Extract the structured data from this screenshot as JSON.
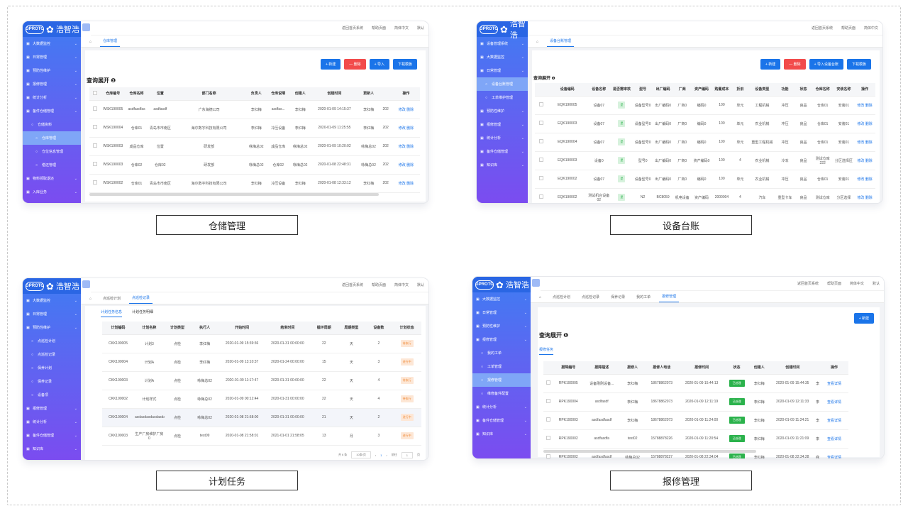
{
  "brand": {
    "logo": "GPROTO",
    "name": "浩智浩"
  },
  "topbar": {
    "home": "返回首页系统",
    "fullscreen": "帮助页面",
    "lang": "简体中文",
    "user": "默认"
  },
  "captions": {
    "warehouse": "仓储管理",
    "equipment": "设备台账",
    "plan": "计划任务",
    "repair": "报修管理"
  },
  "warehouse": {
    "menu": [
      {
        "label": "大数据监控",
        "level": 0
      },
      {
        "label": "日常管理",
        "level": 0
      },
      {
        "label": "预防性维护",
        "level": 0
      },
      {
        "label": "报修管理",
        "level": 0
      },
      {
        "label": "统计分析",
        "level": 0
      },
      {
        "label": "备件仓储管理",
        "level": 0
      },
      {
        "label": "仓储资料",
        "level": 1
      },
      {
        "label": "仓库管理",
        "level": 2,
        "active": true
      },
      {
        "label": "仓位信息管理",
        "level": 2
      },
      {
        "label": "借还管理",
        "level": 2
      },
      {
        "label": "物料领取退还",
        "level": 0
      },
      {
        "label": "入库业务",
        "level": 0
      },
      {
        "label": "出库业务",
        "level": 0
      }
    ],
    "tab": "仓库管理",
    "buttons": {
      "add": "+ 新建",
      "del": "— 删除",
      "import": "+ 导入",
      "template": "下载模板"
    },
    "query": "查询展开",
    "columns": [
      "仓库编号",
      "仓库名称",
      "位置",
      "部门名称",
      "负责人",
      "仓库说明",
      "创建人",
      "创建时间",
      "更新人",
      "",
      "操作"
    ],
    "rows": [
      [
        "WSK190005",
        "asdfasdfas",
        "asdfasdf",
        "广东海德公司",
        "李红梅",
        "asdfas...",
        "李红梅",
        "2020-01-09 14:15:37",
        "李红梅",
        "202",
        "修改 删除"
      ],
      [
        "WSK190004",
        "仓库01",
        "青岛市市南区",
        "海尔数字科技有限公司",
        "李红梅",
        "冷压设备",
        "李红梅",
        "2020-01-09 11:25:55",
        "李红梅",
        "202",
        "修改 删除"
      ],
      [
        "WSK190003",
        "成品仓库",
        "位置",
        "研发部",
        "咏梅总02",
        "成品仓库",
        "咏梅总02",
        "2020-01-09 10:20:02",
        "咏梅总02",
        "202",
        "修改 删除"
      ],
      [
        "WSK190003",
        "仓库02",
        "仓库02",
        "研发部",
        "咏梅总02",
        "仓库02",
        "咏梅总02",
        "2020-01-08 22:48:31",
        "咏梅总02",
        "202",
        "修改 删除"
      ],
      [
        "WSK190002",
        "仓库01",
        "青岛市市南区",
        "海尔数字科技有限公司",
        "李红梅",
        "冷压设备",
        "李红梅",
        "2020-01-08 12:33:12",
        "李红梅",
        "202",
        "修改 删除"
      ]
    ]
  },
  "equipment": {
    "menu": [
      {
        "label": "设备管理系统",
        "level": 0
      },
      {
        "label": "大数据监控",
        "level": 0
      },
      {
        "label": "日常管理",
        "level": 0
      },
      {
        "label": "设备台账管理",
        "level": 1,
        "active": true
      },
      {
        "label": "工单维护管理",
        "level": 1
      },
      {
        "label": "预防性维护",
        "level": 0
      },
      {
        "label": "报修管理",
        "level": 0
      },
      {
        "label": "统计分析",
        "level": 0
      },
      {
        "label": "备件仓储管理",
        "level": 0
      },
      {
        "label": "知识库",
        "level": 0
      }
    ],
    "tab": "设备台账管理",
    "buttons": {
      "add": "+ 新建",
      "del": "— 删除",
      "import": "+ 导入设备台账",
      "template": "下载模板"
    },
    "query": "查询展开",
    "columns": [
      "",
      "设备编码",
      "设备名称",
      "是否需审核",
      "型号",
      "出厂编码",
      "厂商",
      "资产编码",
      "购置成本",
      "折旧",
      "设备类型",
      "功能",
      "状态",
      "仓库名称",
      "安装名称",
      "操作"
    ],
    "rows": [
      [
        "",
        "EQK190005",
        "设备07",
        "是",
        "设备型号0",
        "出厂编码0",
        "厂商0",
        "编码0",
        "100",
        "单元",
        "工程机械",
        "冲压",
        "良品",
        "仓库01",
        "安装01",
        "修改 删除"
      ],
      [
        "",
        "EQK190003",
        "设备07",
        "是",
        "设备型号0",
        "出厂编码0",
        "厂商0",
        "编码0",
        "100",
        "单元",
        "农业机械",
        "冲压",
        "良品",
        "仓库01",
        "安装01",
        "修改 删除"
      ],
      [
        "",
        "EQK190004",
        "设备07",
        "是",
        "设备型号0",
        "出厂编码0",
        "厂商0",
        "编码0",
        "100",
        "单元",
        "重型工程机械",
        "冲压",
        "良品",
        "仓库01",
        "安装01",
        "修改 删除"
      ],
      [
        "",
        "EQK190003",
        "设备0",
        "是",
        "型号0",
        "出厂编码0",
        "厂商0",
        "资产编码0",
        "100",
        "4",
        "农业机械",
        "冷冻",
        "良品",
        "测试仓库222",
        "分区选择区",
        "修改 删除"
      ],
      [
        "",
        "EQK190002",
        "设备07",
        "是",
        "设备型号0",
        "出厂编码0",
        "厂商0",
        "编码0",
        "100",
        "单元",
        "农业机械",
        "冲压",
        "良品",
        "仓库01",
        "安装01",
        "修改 删除"
      ],
      [
        "",
        "EQK190002",
        "测试机台设备02",
        "是",
        "N2",
        "BC8059",
        "机电设备",
        "资产编码",
        "2000004",
        "4",
        "汽车",
        "重型卡车",
        "良品",
        "测试仓库",
        "分区选择",
        "修改 删除"
      ]
    ]
  },
  "plan": {
    "menu": [
      {
        "label": "大数据监控",
        "level": 0
      },
      {
        "label": "日常管理",
        "level": 0
      },
      {
        "label": "预防性维护",
        "level": 0
      },
      {
        "label": "点巡检计划",
        "level": 1
      },
      {
        "label": "点巡检记录",
        "level": 1
      },
      {
        "label": "保养计划",
        "level": 1
      },
      {
        "label": "保养记录",
        "level": 1
      },
      {
        "label": "设备项",
        "level": 1
      },
      {
        "label": "报修管理",
        "level": 0
      },
      {
        "label": "统计分析",
        "level": 0
      },
      {
        "label": "备件仓储管理",
        "level": 0
      },
      {
        "label": "知识库",
        "level": 0
      }
    ],
    "tabs": [
      "点巡检计划",
      "点巡检记录"
    ],
    "subtabs": [
      "计划任务信息",
      "计划任务明细"
    ],
    "columns": [
      "计划编码",
      "计划名称",
      "计划类型",
      "执行人",
      "开始时间",
      "结束时间",
      "循环周期",
      "周期类型",
      "设备数",
      "计划状态"
    ],
    "rows": [
      [
        "CKK190005",
        "计划3",
        "点检",
        "李红梅",
        "2020-01-09 15:39:36",
        "2020-01-31 00:00:00",
        "22",
        "天",
        "2",
        "待执行"
      ],
      [
        "CKK190004",
        "计划A",
        "点检",
        "李红梅",
        "2020-01-09 13:10:37",
        "2020-01-24 00:00:00",
        "15",
        "天",
        "3",
        "进行中"
      ],
      [
        "CKK190003",
        "计划A",
        "点检",
        "咏梅总02",
        "2020-01-09 11:17:47",
        "2020-01-31 00:00:00",
        "22",
        "天",
        "4",
        "待执行"
      ],
      [
        "CKK190002",
        "计划样式",
        "点检",
        "咏梅总02",
        "2020-01-09 00:12:44",
        "2020-01-31 00:00:00",
        "22",
        "天",
        "4",
        "待执行"
      ],
      [
        "CKK190004",
        "asdasdasdasdasdasdasdasd",
        "点检",
        "咏梅总02",
        "2020-01-08 21:58:00",
        "2020-01-31 00:00:00",
        "21",
        "天",
        "2",
        "进行中"
      ],
      [
        "CKK190003",
        "生产厂房维护厂房0",
        "点检",
        "test09",
        "2020-01-08 21:58:01",
        "2021-01-01 21:58:05",
        "13",
        "月",
        "3",
        "进行中"
      ]
    ],
    "pager": {
      "total": "共 6 条",
      "size": "10条/页",
      "page": "1",
      "goto": "前往",
      "pageno": "1",
      "unit": "页"
    }
  },
  "repair": {
    "menu": [
      {
        "label": "大数据监控",
        "level": 0
      },
      {
        "label": "日常管理",
        "level": 0
      },
      {
        "label": "预防性维护",
        "level": 0
      },
      {
        "label": "报修管理",
        "level": 0
      },
      {
        "label": "我的工单",
        "level": 1
      },
      {
        "label": "工单管理",
        "level": 1
      },
      {
        "label": "报修管理",
        "level": 1,
        "active": true
      },
      {
        "label": "维修备件配置",
        "level": 1
      },
      {
        "label": "统计分析",
        "level": 0
      },
      {
        "label": "备件仓储管理",
        "level": 0
      },
      {
        "label": "知识库",
        "level": 0
      }
    ],
    "tabs": [
      "点巡检计划",
      "点巡检记录",
      "保养记录",
      "我的工单",
      "报修管理"
    ],
    "buttons": {
      "add": "+ 新建"
    },
    "query": "查询展开",
    "subtab": "报修任务",
    "columns": [
      "",
      "报障编号",
      "报障描述",
      "报修人",
      "报修人电话",
      "报修时间",
      "状态",
      "创建人",
      "创建时间",
      "",
      "操作"
    ],
    "rows": [
      [
        "",
        "RPK190005",
        "设备刚刚设备...",
        "李红梅",
        "18678862073",
        "2020-01-09 15:44:13",
        "已处理",
        "李红梅",
        "2020-01-09 15:44:35",
        "李",
        "查看详情"
      ],
      [
        "",
        "RPK190004",
        "asdfasdf",
        "李红梅",
        "18678862073",
        "2020-01-09 12:11:19",
        "已处理",
        "李红梅",
        "2020-01-09 12:11:33",
        "李",
        "查看详情"
      ],
      [
        "",
        "RPK190003",
        "asdfasdfasdf",
        "李红梅",
        "18678862073",
        "2020-01-09 11:24:00",
        "已处理",
        "李红梅",
        "2020-01-09 11:24:21",
        "李",
        "查看详情"
      ],
      [
        "",
        "RPK190002",
        "asdfasdfa",
        "test02",
        "15788878226",
        "2020-01-09 11:20:54",
        "已处理",
        "李红梅",
        "2020-01-09 11:21:09",
        "李",
        "查看详情"
      ],
      [
        "",
        "RPK190002",
        "asdfasdfasdf",
        "咏梅总02",
        "15788878227",
        "2020-01-08 22:34:04",
        "已处理",
        "李红梅",
        "2020-01-08 22:34:28",
        "咏",
        "查看详情"
      ]
    ]
  }
}
